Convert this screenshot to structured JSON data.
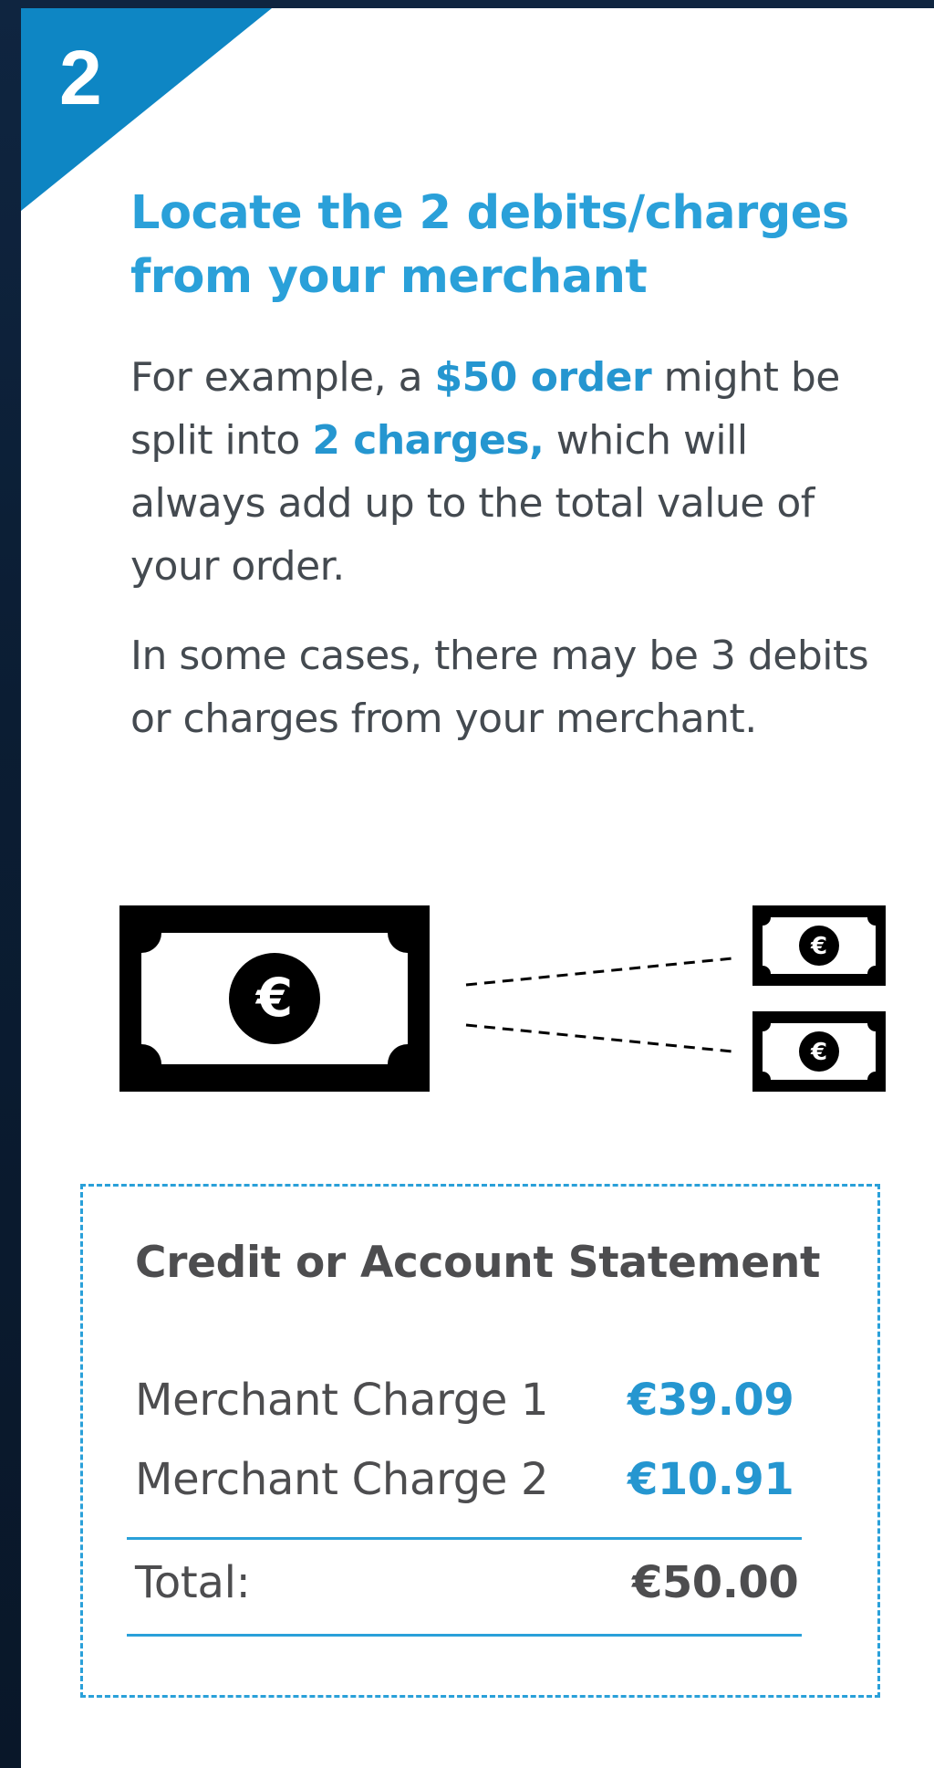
{
  "step": {
    "number": "2",
    "accent_color": "#0e86c4"
  },
  "heading": "Locate the 2 debits/charges from your merchant",
  "intro": {
    "part1": "For example, a ",
    "highlight1": "$50 order",
    "part2": " might be split into ",
    "highlight2": "2 charges,",
    "part3": " which will always add up to the total value of your order."
  },
  "note": "In some cases, there may be 3 debits or charges from your merchant.",
  "illustration": {
    "large_bill_icon": "euro-bill-icon",
    "large_currency_symbol": "€",
    "small_bill_icon": "euro-bill-icon",
    "small_currency_symbol": "€"
  },
  "statement": {
    "title": "Credit or Account Statement",
    "rows": [
      {
        "label": "Merchant Charge 1",
        "amount": "€39.09"
      },
      {
        "label": "Merchant Charge 2",
        "amount": "€10.91"
      }
    ],
    "total": {
      "label": "Total:",
      "amount": "€50.00"
    },
    "border_color": "#2aa0d9",
    "highlight_color": "#2596d0"
  }
}
